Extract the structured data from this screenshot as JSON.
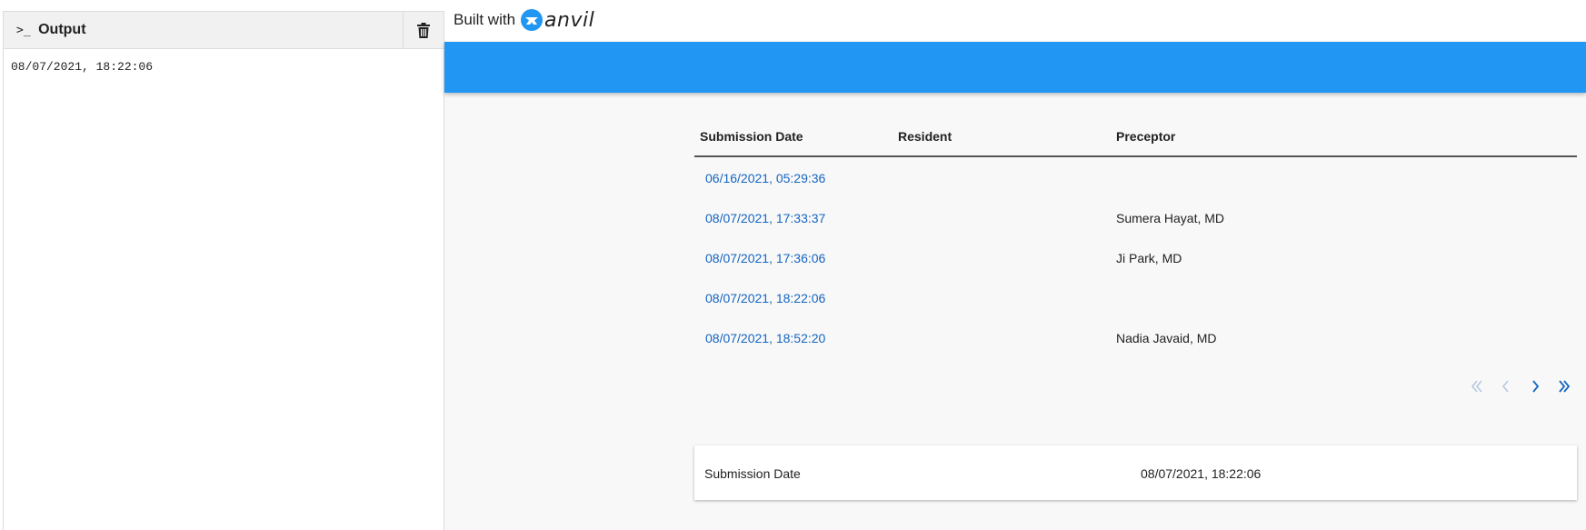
{
  "output": {
    "prompt_glyph": ">_",
    "title": "Output",
    "lines": [
      "08/07/2021, 18:22:06"
    ]
  },
  "branding": {
    "built_with": "Built with",
    "logo_word": "anvil"
  },
  "table": {
    "headers": {
      "submission_date": "Submission Date",
      "resident": "Resident",
      "preceptor": "Preceptor"
    },
    "rows": [
      {
        "date": "06/16/2021, 05:29:36",
        "resident": "",
        "preceptor": ""
      },
      {
        "date": "08/07/2021, 17:33:37",
        "resident": "",
        "preceptor": "Sumera Hayat, MD"
      },
      {
        "date": "08/07/2021, 17:36:06",
        "resident": "",
        "preceptor": "Ji Park, MD"
      },
      {
        "date": "08/07/2021, 18:22:06",
        "resident": "",
        "preceptor": ""
      },
      {
        "date": "08/07/2021, 18:52:20",
        "resident": "",
        "preceptor": "Nadia Javaid, MD"
      }
    ]
  },
  "pagination": {
    "first_icon": "double-chevron-left-icon",
    "prev_icon": "chevron-left-icon",
    "next_icon": "chevron-right-icon",
    "last_icon": "double-chevron-right-icon"
  },
  "detail": {
    "label": "Submission Date",
    "value": "08/07/2021, 18:22:06"
  },
  "colors": {
    "app_bar": "#2196f3",
    "link": "#1565c0",
    "anvil_logo": "#2196f3",
    "disabled": "#b8c8de"
  }
}
